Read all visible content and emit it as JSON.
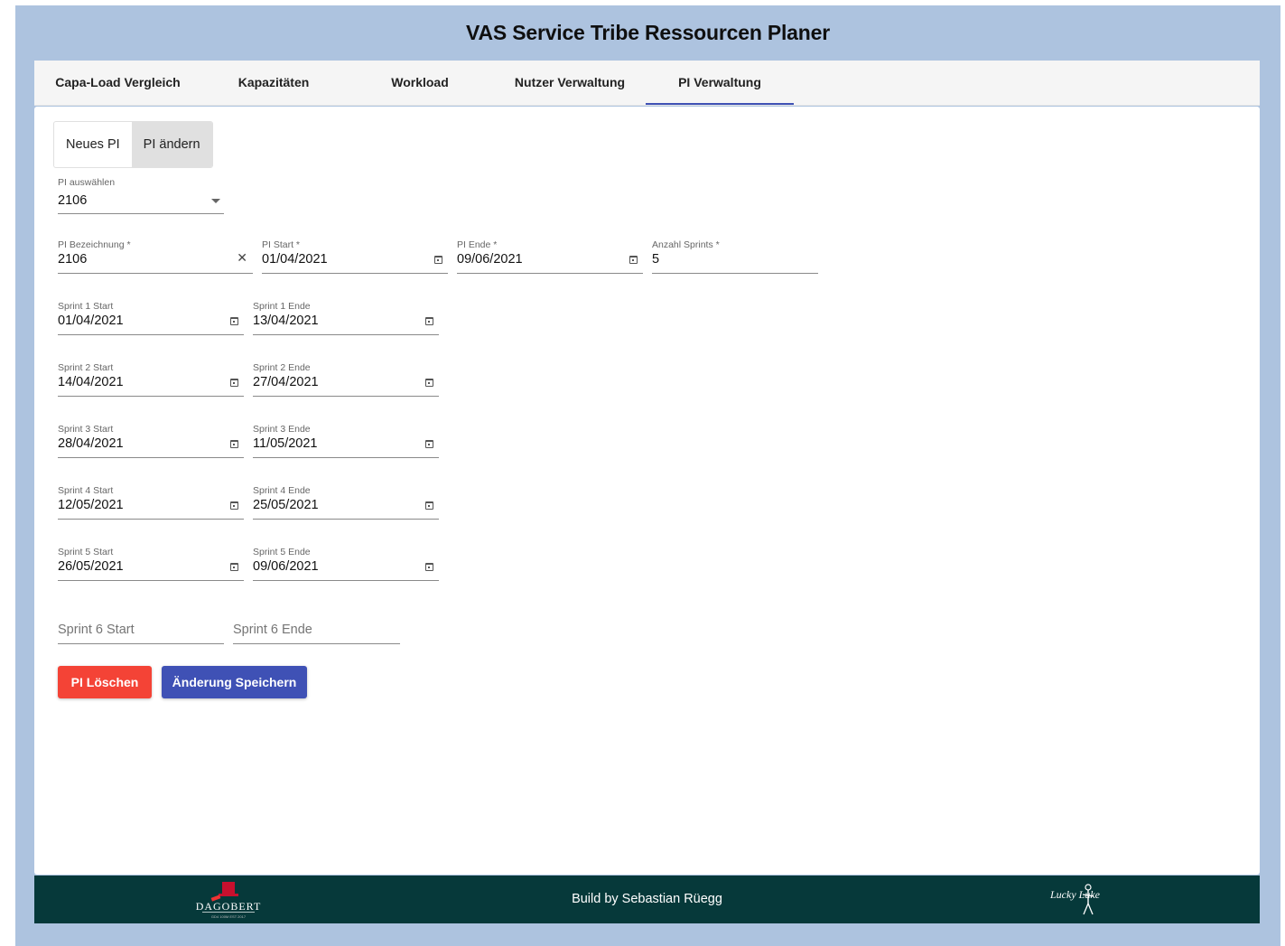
{
  "app": {
    "title": "VAS Service Tribe Ressourcen Planer"
  },
  "tabs": [
    {
      "label": "Capa-Load Vergleich"
    },
    {
      "label": "Kapazitäten"
    },
    {
      "label": "Workload"
    },
    {
      "label": "Nutzer Verwaltung"
    },
    {
      "label": "PI Verwaltung",
      "active": true
    }
  ],
  "mode_toggle": {
    "new_label": "Neues PI",
    "edit_label": "PI ändern",
    "selected": "PI ändern"
  },
  "pi_select": {
    "label": "PI auswählen",
    "value": "2106"
  },
  "pi_form": {
    "name": {
      "label": "PI Bezeichnung *",
      "value": "2106"
    },
    "start": {
      "label": "PI Start *",
      "value": "01/04/2021"
    },
    "end": {
      "label": "PI Ende *",
      "value": "09/06/2021"
    },
    "sprint_count": {
      "label": "Anzahl Sprints *",
      "value": "5"
    }
  },
  "sprints": [
    {
      "start_label": "Sprint 1 Start",
      "start": "01/04/2021",
      "end_label": "Sprint 1 Ende",
      "end": "13/04/2021"
    },
    {
      "start_label": "Sprint 2 Start",
      "start": "14/04/2021",
      "end_label": "Sprint 2 Ende",
      "end": "27/04/2021"
    },
    {
      "start_label": "Sprint 3 Start",
      "start": "28/04/2021",
      "end_label": "Sprint 3 Ende",
      "end": "11/05/2021"
    },
    {
      "start_label": "Sprint 4 Start",
      "start": "12/05/2021",
      "end_label": "Sprint 4 Ende",
      "end": "25/05/2021"
    },
    {
      "start_label": "Sprint 5 Start",
      "start": "26/05/2021",
      "end_label": "Sprint 5 Ende",
      "end": "09/06/2021"
    }
  ],
  "sprint6": {
    "start_placeholder": "Sprint 6 Start",
    "end_placeholder": "Sprint 6 Ende"
  },
  "actions": {
    "delete_label": "PI Löschen",
    "save_label": "Änderung Speichern"
  },
  "footer": {
    "text": "Build by Sebastian Rüegg",
    "logo_left_text": "DAGOBERT",
    "logo_left_subtext": "GD4 100M EST 2017",
    "logo_right_text": "Lucky Luke"
  },
  "colors": {
    "background": "#adc3df",
    "primary": "#3f51b5",
    "danger": "#f44336",
    "footer": "#06393a"
  },
  "icons": [
    "calendar-icon",
    "clear-icon",
    "dropdown-caret-icon",
    "dagobert-logo",
    "lucky-luke-logo"
  ]
}
